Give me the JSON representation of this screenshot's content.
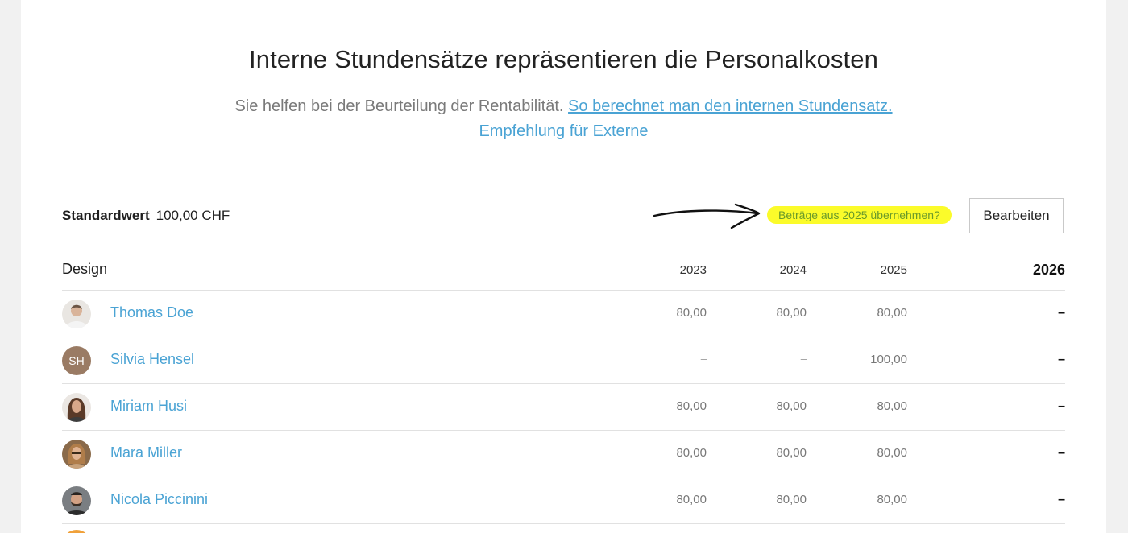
{
  "header": {
    "title": "Interne Stundensätze repräsentieren die Personalkosten",
    "subtitle_text": "Sie helfen bei der Beurteilung der Rentabilität.",
    "subtitle_link": "So berechnet man den internen Stundensatz.",
    "external_link": "Empfehlung für Externe"
  },
  "standard": {
    "label": "Standardwert",
    "value": "100,00 CHF"
  },
  "actions": {
    "copy_label": "Beträge aus 2025 übernehmen?",
    "edit_label": "Bearbeiten"
  },
  "table": {
    "group": "Design",
    "years": [
      "2023",
      "2024",
      "2025",
      "2026"
    ],
    "rows": [
      {
        "name": "Thomas Doe",
        "initials": "",
        "values": [
          "80,00",
          "80,00",
          "80,00",
          "–"
        ]
      },
      {
        "name": "Silvia Hensel",
        "initials": "SH",
        "values": [
          "–",
          "–",
          "100,00",
          "–"
        ]
      },
      {
        "name": "Miriam Husi",
        "initials": "",
        "values": [
          "80,00",
          "80,00",
          "80,00",
          "–"
        ]
      },
      {
        "name": "Mara Miller",
        "initials": "",
        "values": [
          "80,00",
          "80,00",
          "80,00",
          "–"
        ]
      },
      {
        "name": "Nicola Piccinini",
        "initials": "",
        "values": [
          "80,00",
          "80,00",
          "80,00",
          "–"
        ]
      }
    ]
  },
  "colors": {
    "link": "#4aa3d4",
    "highlight": "#fbfb2a",
    "highlight_text": "#6a9a2a",
    "initials_avatar": "#9a7b64"
  }
}
